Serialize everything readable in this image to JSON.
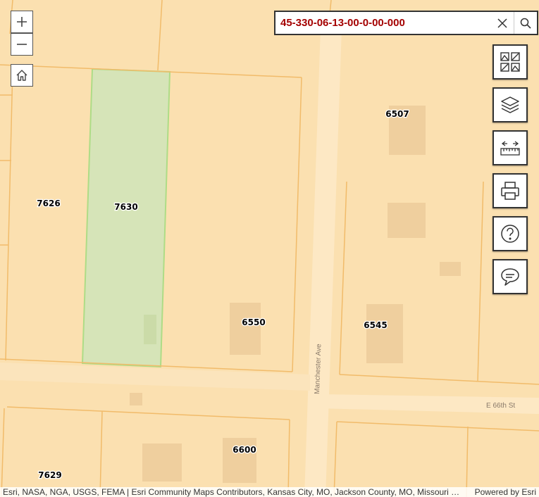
{
  "search": {
    "value": "45-330-06-13-00-0-00-000"
  },
  "parcels": {
    "p7626": "7626",
    "p7630": "7630",
    "p6507": "6507",
    "p6550": "6550",
    "p6545": "6545",
    "p6600": "6600",
    "p7629": "7629"
  },
  "streets": {
    "manchester": "Manchester Ave",
    "e66th": "E 66th St"
  },
  "attribution": {
    "text": "Esri, NASA, NGA, USGS, FEMA | Esri Community Maps Contributors, Kansas City, MO, Jackson County, MO, Missouri DNR, Esri, HERE, Garmin, SafeGraph, METI/NASA, USGS, EPA, NPS, USDA",
    "powered": "Powered by Esri"
  },
  "icons": {
    "zoom_in": "plus-icon",
    "zoom_out": "minus-icon",
    "home": "home-icon",
    "clear": "close-icon",
    "search": "search-icon",
    "basemap": "basemap-gallery-icon",
    "layers": "layers-icon",
    "measure": "measure-ruler-icon",
    "print": "print-icon",
    "help": "help-icon",
    "feedback": "comment-icon"
  },
  "colors": {
    "base": "#fbe0b0",
    "parcel_line": "#f1bb6a",
    "selected_fill": "#d6e4b8",
    "selected_outline": "#aedc86",
    "label_value": "#a40000"
  }
}
